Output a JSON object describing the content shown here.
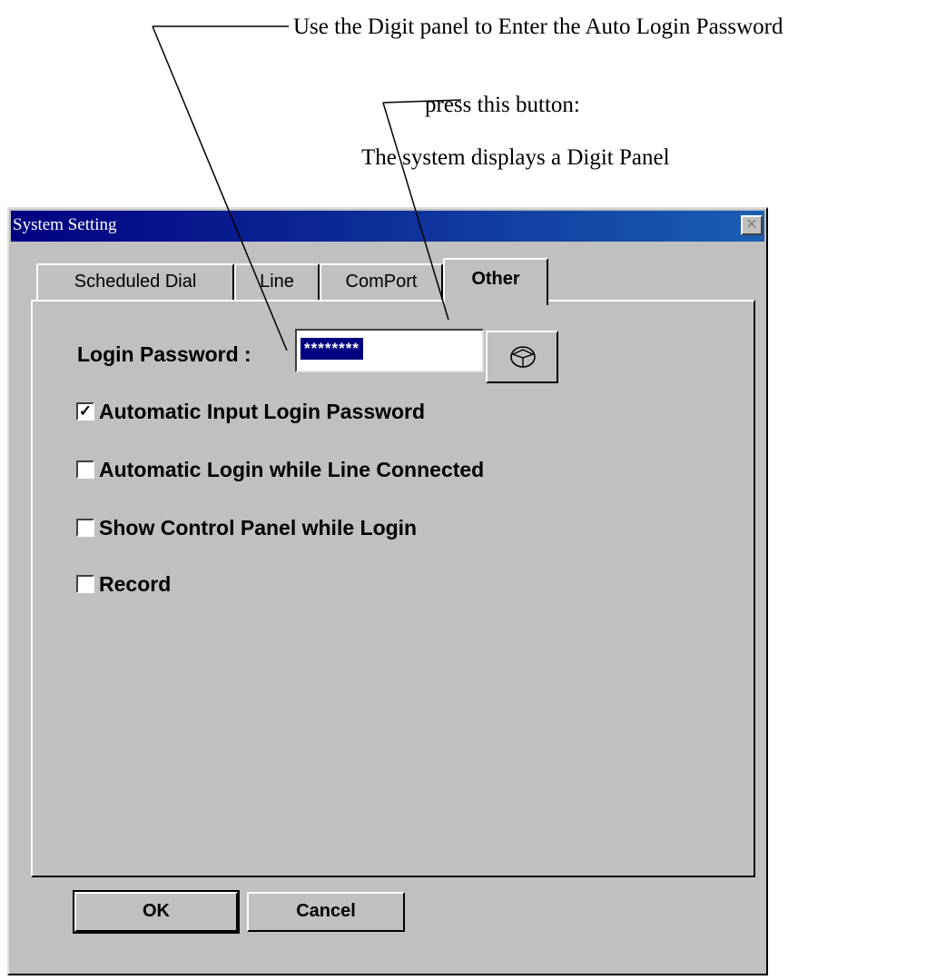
{
  "annotations": {
    "line1": "Use the Digit panel to Enter the Auto Login Password",
    "line2": "press this button:",
    "line3": "The system displays a Digit Panel"
  },
  "dialog": {
    "title": "System Setting",
    "close_glyph": "✕",
    "tabs": [
      {
        "label": "Scheduled Dial",
        "active": false
      },
      {
        "label": "Line",
        "active": false
      },
      {
        "label": "ComPort",
        "active": false
      },
      {
        "label": "Other",
        "active": true
      }
    ],
    "login_password_label": "Login Password :",
    "login_password_value": "********",
    "digit_button_icon": "digit-panel-icon",
    "checkboxes": [
      {
        "label": "Automatic Input Login Password",
        "checked": true,
        "mark": "✓"
      },
      {
        "label": "Automatic Login while Line Connected",
        "checked": false,
        "mark": ""
      },
      {
        "label": "Show Control Panel while Login",
        "checked": false,
        "mark": ""
      },
      {
        "label": "Record",
        "checked": false,
        "mark": ""
      }
    ],
    "ok_label": "OK",
    "cancel_label": "Cancel"
  },
  "colors": {
    "titlebar_start": "#000080",
    "titlebar_end": "#1a5fb4",
    "face": "#c0c0c0",
    "selection": "#000080"
  }
}
